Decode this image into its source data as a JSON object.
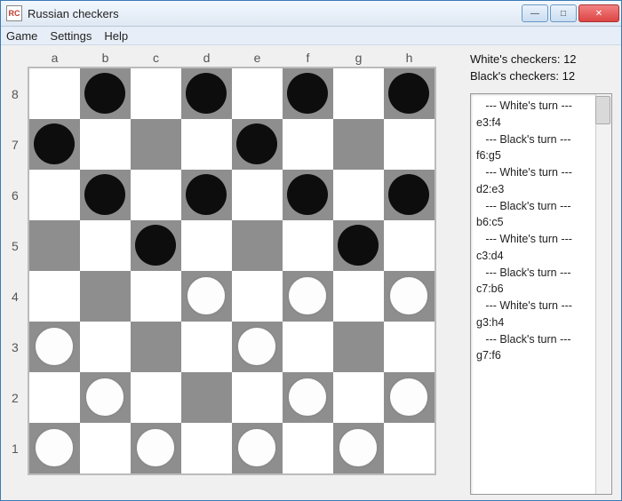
{
  "window": {
    "title": "Russian checkers",
    "icon_text": "RC",
    "buttons": {
      "min": "—",
      "max": "□",
      "close": "✕"
    }
  },
  "menu": {
    "game": "Game",
    "settings": "Settings",
    "help": "Help"
  },
  "board": {
    "files": [
      "a",
      "b",
      "c",
      "d",
      "e",
      "f",
      "g",
      "h"
    ],
    "ranks": [
      "8",
      "7",
      "6",
      "5",
      "4",
      "3",
      "2",
      "1"
    ],
    "pieces": [
      {
        "file": "b",
        "rank": "8",
        "color": "black"
      },
      {
        "file": "d",
        "rank": "8",
        "color": "black"
      },
      {
        "file": "f",
        "rank": "8",
        "color": "black"
      },
      {
        "file": "h",
        "rank": "8",
        "color": "black"
      },
      {
        "file": "a",
        "rank": "7",
        "color": "black"
      },
      {
        "file": "e",
        "rank": "7",
        "color": "black"
      },
      {
        "file": "b",
        "rank": "6",
        "color": "black"
      },
      {
        "file": "d",
        "rank": "6",
        "color": "black"
      },
      {
        "file": "f",
        "rank": "6",
        "color": "black"
      },
      {
        "file": "h",
        "rank": "6",
        "color": "black"
      },
      {
        "file": "c",
        "rank": "5",
        "color": "black"
      },
      {
        "file": "g",
        "rank": "5",
        "color": "black"
      },
      {
        "file": "d",
        "rank": "4",
        "color": "white"
      },
      {
        "file": "f",
        "rank": "4",
        "color": "white"
      },
      {
        "file": "h",
        "rank": "4",
        "color": "white"
      },
      {
        "file": "a",
        "rank": "3",
        "color": "white"
      },
      {
        "file": "e",
        "rank": "3",
        "color": "white"
      },
      {
        "file": "b",
        "rank": "2",
        "color": "white"
      },
      {
        "file": "f",
        "rank": "2",
        "color": "white"
      },
      {
        "file": "h",
        "rank": "2",
        "color": "white"
      },
      {
        "file": "a",
        "rank": "1",
        "color": "white"
      },
      {
        "file": "c",
        "rank": "1",
        "color": "white"
      },
      {
        "file": "e",
        "rank": "1",
        "color": "white"
      },
      {
        "file": "g",
        "rank": "1",
        "color": "white"
      }
    ]
  },
  "side": {
    "white_label": "White's checkers: 12",
    "black_label": "Black's checkers: 12",
    "moves": [
      "   --- White's turn ---",
      "e3:f4",
      "   --- Black's turn ---",
      "f6:g5",
      "   --- White's turn ---",
      "d2:e3",
      "   --- Black's turn ---",
      "b6:c5",
      "   --- White's turn ---",
      "c3:d4",
      "   --- Black's turn ---",
      "c7:b6",
      "   --- White's turn ---",
      "g3:h4",
      "   --- Black's turn ---",
      "g7:f6"
    ]
  }
}
